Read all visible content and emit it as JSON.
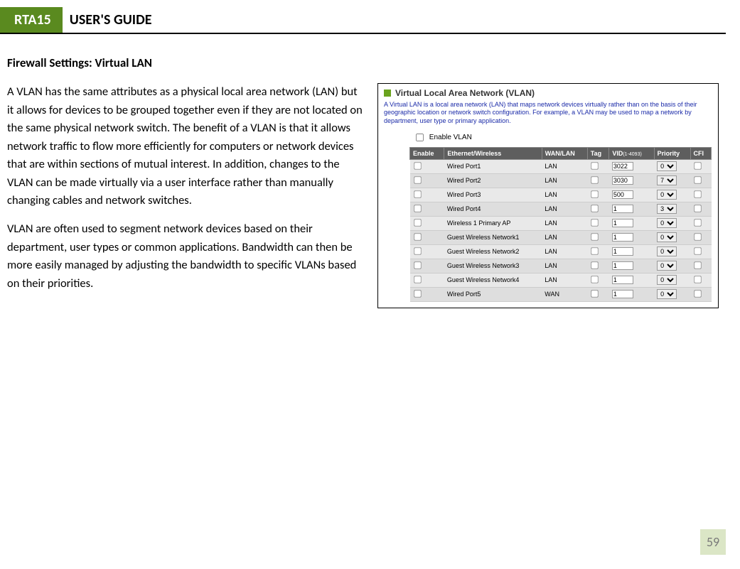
{
  "header": {
    "badge": "RTA15",
    "title": "USER'S GUIDE"
  },
  "section_title": "Firewall Settings: Virtual LAN",
  "para1": "A VLAN has the same attributes as a physical local area network (LAN) but it allows for devices to be grouped together even if they are not located on the same physical network switch.  The benefit of a VLAN is that it allows network traffic to flow more efficiently for computers or network devices that are within sections of mutual interest.  In addition, changes to the VLAN can be made virtually via a user interface rather than manually changing cables and network switches.",
  "para2": "VLAN are often used to segment network devices based on their department, user types or common applications.  Bandwidth can then be more easily managed by adjusting the bandwidth to specific VLANs based on their priorities.",
  "figure": {
    "title": "Virtual Local Area Network (VLAN)",
    "desc": "A Virtual LAN is a local area network (LAN) that maps network devices virtually rather than on the basis of their geographic location or network switch configuration. For example, a VLAN may be used to map a network by department, user type or primary application.",
    "enable_label": "Enable VLAN",
    "headers": {
      "enable": "Enable",
      "eth": "Ethernet/Wireless",
      "wanlan": "WAN/LAN",
      "tag": "Tag",
      "vid": "VID",
      "vid_sub": "(1-4093)",
      "priority": "Priority",
      "cfi": "CFI"
    },
    "rows": [
      {
        "name": "Wired Port1",
        "wl": "LAN",
        "vid": "3022",
        "pri": "0",
        "indent": false
      },
      {
        "name": "Wired Port2",
        "wl": "LAN",
        "vid": "3030",
        "pri": "7",
        "indent": false
      },
      {
        "name": "Wired Port3",
        "wl": "LAN",
        "vid": "500",
        "pri": "0",
        "indent": false
      },
      {
        "name": "Wired Port4",
        "wl": "LAN",
        "vid": "1",
        "pri": "3",
        "indent": false
      },
      {
        "name": "Wireless 1 Primary AP",
        "wl": "LAN",
        "vid": "1",
        "pri": "0",
        "indent": false
      },
      {
        "name": "Guest Wireless Network1",
        "wl": "LAN",
        "vid": "1",
        "pri": "0",
        "indent": true
      },
      {
        "name": "Guest Wireless Network2",
        "wl": "LAN",
        "vid": "1",
        "pri": "0",
        "indent": true
      },
      {
        "name": "Guest Wireless Network3",
        "wl": "LAN",
        "vid": "1",
        "pri": "0",
        "indent": true
      },
      {
        "name": "Guest Wireless Network4",
        "wl": "LAN",
        "vid": "1",
        "pri": "0",
        "indent": true
      },
      {
        "name": "Wired Port5",
        "wl": "WAN",
        "vid": "1",
        "pri": "0",
        "indent": false
      }
    ]
  },
  "page_number": "59"
}
